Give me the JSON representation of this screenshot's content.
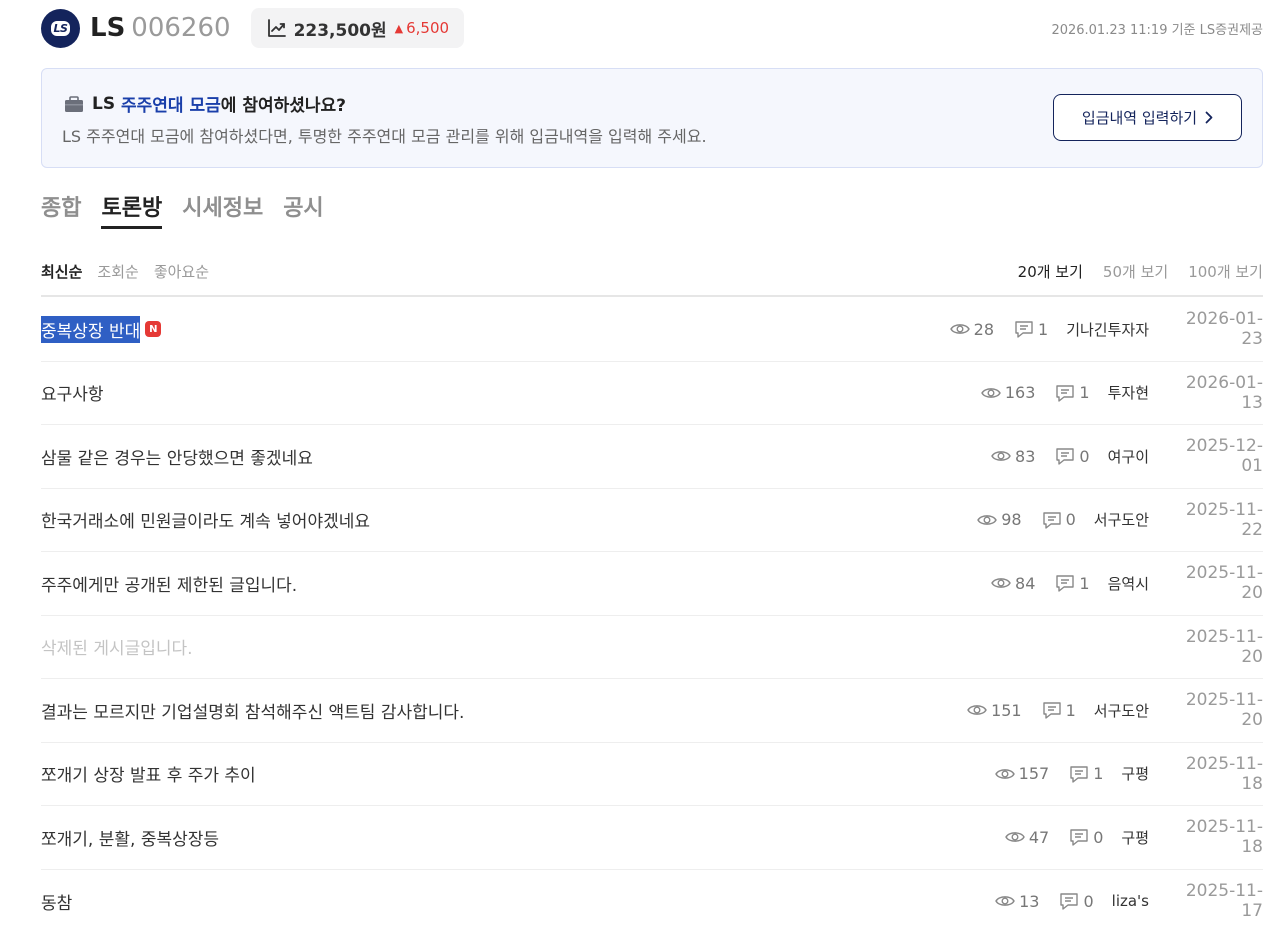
{
  "header": {
    "logo_text": "LS",
    "stock_name": "LS",
    "stock_code": "006260",
    "price": "223,500원",
    "change": "6,500",
    "change_color": "#e53935",
    "as_of": "2026.01.23 11:19 기준 LS증권제공"
  },
  "banner": {
    "title_prefix": "LS ",
    "title_highlight": "주주연대 모금",
    "title_suffix": "에 참여하셨나요?",
    "description": "LS 주주연대 모금에 참여하셨다면, 투명한 주주연대 모금 관리를 위해 입금내역을 입력해 주세요.",
    "button_label": "입금내역 입력하기"
  },
  "tabs": [
    {
      "label": "종합",
      "active": false
    },
    {
      "label": "토론방",
      "active": true
    },
    {
      "label": "시세정보",
      "active": false
    },
    {
      "label": "공시",
      "active": false
    }
  ],
  "sort": {
    "options": [
      "최신순",
      "조회순",
      "좋아요순"
    ],
    "active": "최신순",
    "page_sizes": [
      "20개 보기",
      "50개 보기",
      "100개 보기"
    ],
    "active_page_size": "20개 보기"
  },
  "posts": [
    {
      "title": "중복상장 반대",
      "is_new": true,
      "new_label": "N",
      "selected": true,
      "views": "28",
      "comments": "1",
      "author": "기나긴투자자",
      "date": "2026-01-23"
    },
    {
      "title": "요구사항",
      "views": "163",
      "comments": "1",
      "author": "투자현",
      "date": "2026-01-13"
    },
    {
      "title": "삼물 같은 경우는 안당했으면 좋겠네요",
      "views": "83",
      "comments": "0",
      "author": "여구이",
      "date": "2025-12-01"
    },
    {
      "title": "한국거래소에 민원글이라도 계속 넣어야겠네요",
      "views": "98",
      "comments": "0",
      "author": "서구도안",
      "date": "2025-11-22"
    },
    {
      "title": "주주에게만 공개된 제한된 글입니다.",
      "views": "84",
      "comments": "1",
      "author": "음역시",
      "date": "2025-11-20"
    },
    {
      "title": "삭제된 게시글입니다.",
      "deleted": true,
      "date": "2025-11-20"
    },
    {
      "title": "결과는 모르지만 기업설명회 참석해주신 액트팀 감사합니다.",
      "views": "151",
      "comments": "1",
      "author": "서구도안",
      "date": "2025-11-20"
    },
    {
      "title": "쪼개기 상장 발표 후 주가 추이",
      "views": "157",
      "comments": "1",
      "author": "구평",
      "date": "2025-11-18"
    },
    {
      "title": "쪼개기, 분활, 중복상장등",
      "views": "47",
      "comments": "0",
      "author": "구평",
      "date": "2025-11-18"
    },
    {
      "title": "동참",
      "views": "13",
      "comments": "0",
      "author": "liza's",
      "date": "2025-11-17"
    }
  ],
  "icons": {
    "trend": "trend-up-icon",
    "views": "eye-icon",
    "comments": "comment-icon",
    "chevron": "chevron-right-icon",
    "banner": "shopping-bag-icon"
  },
  "colors": {
    "brand": "#14245c",
    "highlight": "#1a3faa",
    "up": "#e53935",
    "new_badge": "#e53935",
    "selection": "#2f5fc4"
  }
}
